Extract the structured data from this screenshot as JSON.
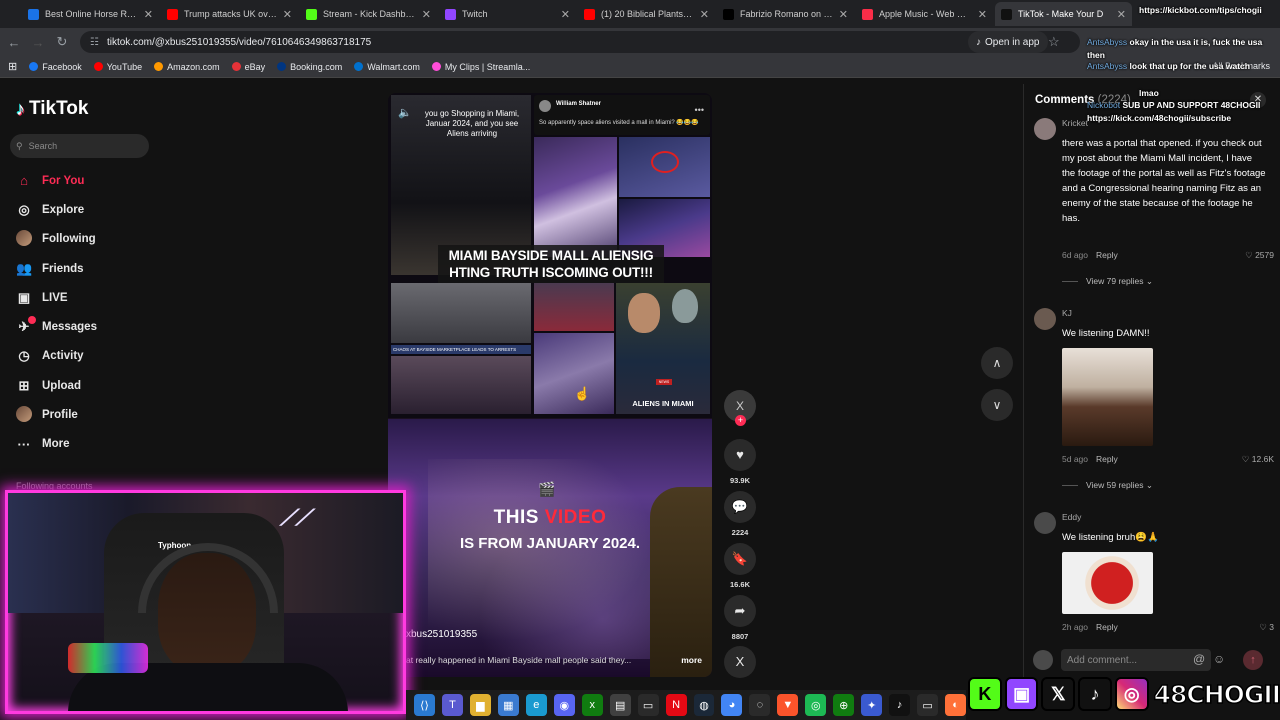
{
  "browser": {
    "tabs": [
      {
        "label": "Best Online Horse Racing",
        "color": "#1a73e8"
      },
      {
        "label": "Trump attacks UK over Ira",
        "color": "#ff0000"
      },
      {
        "label": "Stream - Kick Dashboard",
        "color": "#53fc18"
      },
      {
        "label": "Twitch",
        "color": "#9146ff"
      },
      {
        "label": "(1) 20 Biblical Plants That",
        "color": "#ff0000"
      },
      {
        "label": "Fabrizio Romano on X: \"",
        "color": "#000000"
      },
      {
        "label": "Apple Music - Web Player",
        "color": "#fa2d48"
      },
      {
        "label": "TikTok - Make Your D",
        "color": "#111111"
      }
    ],
    "url": "tiktok.com/@xbus251019355/video/7610646349863718175",
    "open_in_app": "Open in app",
    "bookmarks": [
      {
        "label": "Facebook",
        "color": "#1877f2"
      },
      {
        "label": "YouTube",
        "color": "#ff0000"
      },
      {
        "label": "Amazon.com",
        "color": "#ff9900"
      },
      {
        "label": "eBay",
        "color": "#e53238"
      },
      {
        "label": "Booking.com",
        "color": "#003580"
      },
      {
        "label": "Walmart.com",
        "color": "#0071ce"
      },
      {
        "label": "My Clips | Streamla...",
        "color": "#ff4dd8"
      }
    ],
    "all_bookmarks": "All Bookmarks"
  },
  "tiktok": {
    "brand": "TikTok",
    "search_placeholder": "Search",
    "nav": [
      {
        "label": "For You",
        "icon": "home-icon",
        "glyph": "⌂"
      },
      {
        "label": "Explore",
        "icon": "compass-icon",
        "glyph": "◎"
      },
      {
        "label": "Following",
        "icon": "following-avatar-icon",
        "glyph": ""
      },
      {
        "label": "Friends",
        "icon": "friends-icon",
        "glyph": "👥"
      },
      {
        "label": "LIVE",
        "icon": "live-icon",
        "glyph": "▣"
      },
      {
        "label": "Messages",
        "icon": "messages-icon",
        "glyph": "✈"
      },
      {
        "label": "Activity",
        "icon": "activity-icon",
        "glyph": "◷"
      },
      {
        "label": "Upload",
        "icon": "upload-icon",
        "glyph": "⊞"
      },
      {
        "label": "Profile",
        "icon": "profile-icon",
        "glyph": ""
      },
      {
        "label": "More",
        "icon": "more-icon",
        "glyph": "···"
      }
    ],
    "following_accounts": "Following accounts",
    "messages_badge": "1"
  },
  "video": {
    "clip_caption": "you go Shopping in Miami, Januar 2024, and you see Aliens arriving",
    "tweet_name": "William Shatner",
    "tweet_text": "So apparently space aliens visited a mall in Miami? 😂😂😂",
    "headline": "MIAMI BAYSIDE MALL ALIENSIG HTING TRUTH ISCOMING OUT!!!",
    "chaos_caption": "CHAOS AT BAYSIDE MARKETPLACE LEADS TO ARRESTS",
    "news_tag": "NEWS",
    "aliens_label": "ALIENS IN MIAMI",
    "big_line1_a": "THIS ",
    "big_line1_b": "VIDEO",
    "big_line2": "IS FROM JANUARY 2024.",
    "author": "xbus251019355",
    "description": "at really happened in Miami Bayside mall people said they...",
    "more": "more"
  },
  "rail": {
    "avatar_letter": "X",
    "likes": "93.9K",
    "comments": "2224",
    "saves": "16.6K",
    "shares": "8807",
    "bottom_letter": "X"
  },
  "comments": {
    "title": "Comments",
    "count": "(2224)",
    "items": [
      {
        "name": "Kricket",
        "text": "there was a portal that opened. if you check out my post about the Miami Mall incident, I have the footage of the portal as well as Fitz's footage and a Congressional hearing naming Fitz as an enemy of the state because of the footage he has.",
        "age": "6d ago",
        "reply": "Reply",
        "likes": "2579",
        "view_replies": "View 79 replies"
      },
      {
        "name": "KJ",
        "text": "We listening DAMN!!",
        "age": "5d ago",
        "reply": "Reply",
        "likes": "12.6K",
        "view_replies": "View 59 replies"
      },
      {
        "name": "Eddy",
        "text": "We listening bruh😩🙏",
        "age": "2h ago",
        "reply": "Reply",
        "likes": "3"
      }
    ],
    "add_placeholder": "Add comment..."
  },
  "chat": [
    {
      "user": "",
      "text": "https://kickbot.com/tips/chogii"
    },
    {
      "user": "AntsAbyss",
      "text": "okay in the usa it is, fuck the usa then"
    },
    {
      "user": "AntsAbyss",
      "text": "look that up for the usa watch"
    },
    {
      "user": "",
      "text": "lmao"
    },
    {
      "user": "Nickobot",
      "text": "SUB UP AND SUPPORT 48CHOGII https://kick.com/48chogii/subscribe"
    }
  ],
  "webcam": {
    "chair_brand": "Typhoon"
  },
  "overlay": {
    "handle": "48CHOGII"
  }
}
